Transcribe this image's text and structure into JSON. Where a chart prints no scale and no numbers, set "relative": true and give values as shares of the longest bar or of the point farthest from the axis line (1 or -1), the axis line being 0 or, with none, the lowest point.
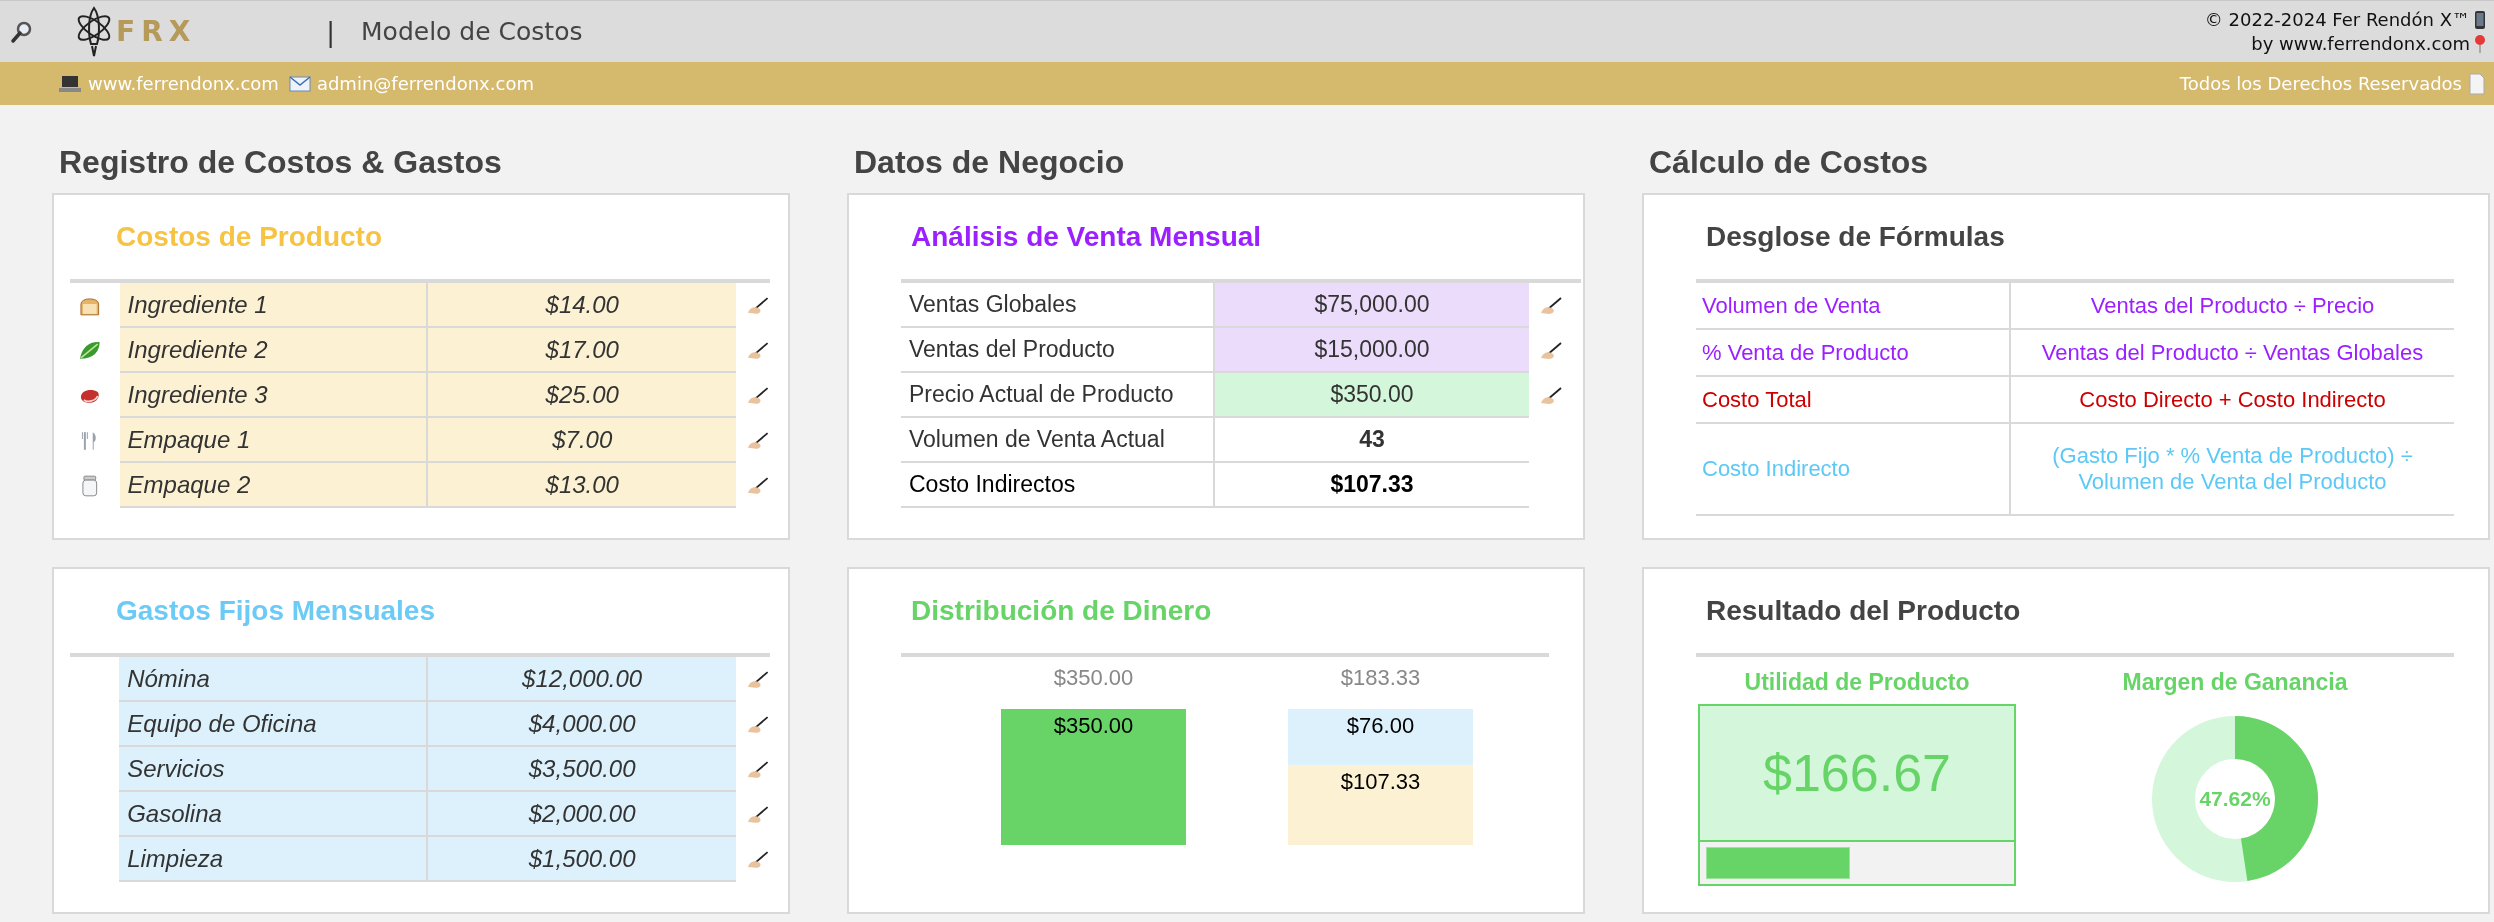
{
  "header": {
    "logo_text": "FRX",
    "separator": "|",
    "title": "Modelo de Costos",
    "copyright": "© 2022-2024 Fer Rendón X™",
    "byline": "by www.ferrendonx.com"
  },
  "info_bar": {
    "website": "www.ferrendonx.com",
    "email": "admin@ferrendonx.com",
    "rights": "Todos los Derechos Reservados"
  },
  "columns": [
    {
      "heading": "Registro de Costos & Gastos"
    },
    {
      "heading": "Datos de Negocio"
    },
    {
      "heading": "Cálculo de Costos"
    }
  ],
  "product_costs": {
    "title": "Costos de Producto",
    "rows": [
      {
        "kind": "bread",
        "name": "Ingrediente 1",
        "value": "$14.00"
      },
      {
        "kind": "lettuce",
        "name": "Ingrediente 2",
        "value": "$17.00"
      },
      {
        "kind": "meat",
        "name": "Ingrediente 3",
        "value": "$25.00"
      },
      {
        "kind": "utensils",
        "name": "Empaque 1",
        "value": "$7.00"
      },
      {
        "kind": "jar",
        "name": "Empaque 2",
        "value": "$13.00"
      }
    ]
  },
  "fixed_expenses": {
    "title": "Gastos Fijos Mensuales",
    "rows": [
      {
        "name": "Nómina",
        "value": "$12,000.00"
      },
      {
        "name": "Equipo de Oficina",
        "value": "$4,000.00"
      },
      {
        "name": "Servicios",
        "value": "$3,500.00"
      },
      {
        "name": "Gasolina",
        "value": "$2,000.00"
      },
      {
        "name": "Limpieza",
        "value": "$1,500.00"
      }
    ]
  },
  "sales_analysis": {
    "title": "Análisis de Venta Mensual",
    "rows": [
      {
        "kind": "sales_input",
        "label": "Ventas Globales",
        "value": "$75,000.00"
      },
      {
        "kind": "sales_input",
        "label": "Ventas del Producto",
        "value": "$15,000.00"
      },
      {
        "kind": "price_input",
        "label": "Precio Actual de Producto",
        "value": "$350.00"
      },
      {
        "kind": "result",
        "label": "Volumen de Venta Actual",
        "value": "43"
      },
      {
        "kind": "total",
        "label": "Costo Indirectos",
        "value": "$107.33"
      }
    ]
  },
  "formulas": {
    "title": "Desglose de Fórmulas",
    "rows": [
      {
        "term": "Volumen de Venta",
        "formula": "Ventas del Producto ÷ Precio",
        "color": "#9b1fff"
      },
      {
        "term": "% Venta de Producto",
        "formula": "Ventas del Producto ÷ Ventas Globales",
        "color": "#9b1fff"
      },
      {
        "term": "Costo Total",
        "formula": "Costo Directo + Costo Indirecto",
        "color": "#cc0000"
      },
      {
        "term": "Costo Indirecto",
        "formula": "(Gasto Fijo * % Venta de Producto) ÷ Volumen de Venta del Producto",
        "color": "#5bc8f5"
      }
    ]
  },
  "distribution": {
    "title": "Distribución de Dinero",
    "chart_data": {
      "type": "bar",
      "stacked": true,
      "relative": true,
      "series": [
        {
          "color": "#68d468",
          "values": [
            1,
            null
          ]
        },
        {
          "color": "#dcf1fc",
          "values": [
            null,
            0.4146
          ]
        },
        {
          "color": "#fcf1d2",
          "values": [
            null,
            0.5854
          ]
        }
      ],
      "value_labels": [
        [
          "$350.00",
          null
        ],
        [
          null,
          "$76.00"
        ],
        [
          null,
          "$107.33"
        ]
      ],
      "annotations": [
        "$350.00",
        "$183.33"
      ]
    }
  },
  "result": {
    "title": "Resultado del Producto",
    "profit": {
      "label": "Utilidad de Producto",
      "value": "$166.67",
      "level": 0.4762
    },
    "margin": {
      "label": "Margen de Ganancia",
      "value": "47.62%",
      "level": 0.4762
    }
  }
}
